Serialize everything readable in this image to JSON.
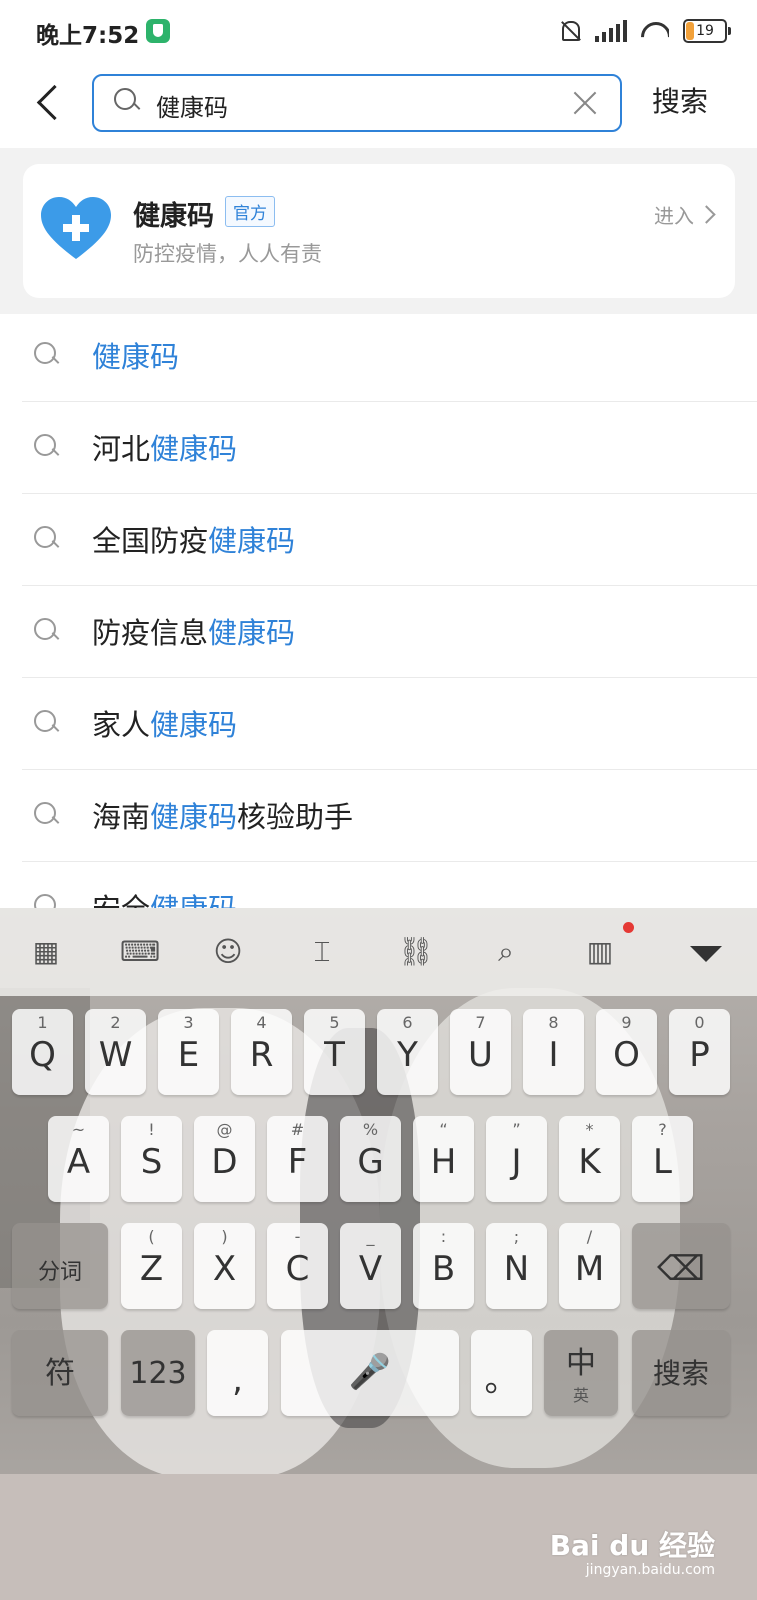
{
  "status": {
    "time": "晚上7:52",
    "battery": "19"
  },
  "search": {
    "query": "健康码",
    "button": "搜索"
  },
  "official": {
    "title": "健康码",
    "badge": "官方",
    "subtitle": "防控疫情，人人有责",
    "enter": "进入"
  },
  "suggestions": [
    {
      "pre": "",
      "hl": "健康码",
      "post": ""
    },
    {
      "pre": "河北",
      "hl": "健康码",
      "post": ""
    },
    {
      "pre": "全国防疫",
      "hl": "健康码",
      "post": ""
    },
    {
      "pre": "防疫信息",
      "hl": "健康码",
      "post": ""
    },
    {
      "pre": "家人",
      "hl": "健康码",
      "post": ""
    },
    {
      "pre": "海南",
      "hl": "健康码",
      "post": "核验助手"
    },
    {
      "pre": "安全",
      "hl": "健康码",
      "post": ""
    }
  ],
  "keyboard": {
    "row1": [
      {
        "k": "Q",
        "s": "1"
      },
      {
        "k": "W",
        "s": "2"
      },
      {
        "k": "E",
        "s": "3"
      },
      {
        "k": "R",
        "s": "4"
      },
      {
        "k": "T",
        "s": "5"
      },
      {
        "k": "Y",
        "s": "6"
      },
      {
        "k": "U",
        "s": "7"
      },
      {
        "k": "I",
        "s": "8"
      },
      {
        "k": "O",
        "s": "9"
      },
      {
        "k": "P",
        "s": "0"
      }
    ],
    "row2": [
      {
        "k": "A",
        "s": "~"
      },
      {
        "k": "S",
        "s": "!"
      },
      {
        "k": "D",
        "s": "@"
      },
      {
        "k": "F",
        "s": "#"
      },
      {
        "k": "G",
        "s": "%"
      },
      {
        "k": "H",
        "s": "“"
      },
      {
        "k": "J",
        "s": "”"
      },
      {
        "k": "K",
        "s": "*"
      },
      {
        "k": "L",
        "s": "?"
      }
    ],
    "row3": [
      {
        "k": "Z",
        "s": "("
      },
      {
        "k": "X",
        "s": ")"
      },
      {
        "k": "C",
        "s": "-"
      },
      {
        "k": "V",
        "s": "_"
      },
      {
        "k": "B",
        "s": ":"
      },
      {
        "k": "N",
        "s": ";"
      },
      {
        "k": "M",
        "s": "/"
      }
    ],
    "shift_label": "分词",
    "symbols": "符",
    "num": "123",
    "comma": ",",
    "period": "。",
    "lang_main": "中",
    "lang_sub": "英",
    "enter": "搜索"
  },
  "watermark": {
    "brand": "Bai du 经验",
    "url": "jingyan.baidu.com"
  }
}
